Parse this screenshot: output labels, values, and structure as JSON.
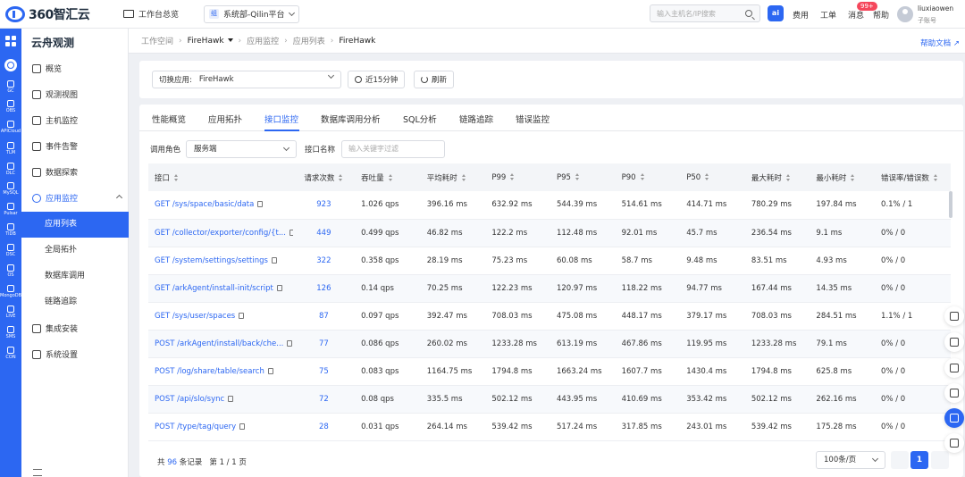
{
  "topbar": {
    "logo_text": "360智汇云",
    "workspace_overview": "工作台总览",
    "org_badge": "组",
    "org_name": "系统部-Qilin平台",
    "search_placeholder": "输入主机名/IP搜索",
    "ai_label": "ai",
    "links": {
      "cost": "费用",
      "ticket": "工单",
      "message": "消息",
      "help": "帮助"
    },
    "message_badge": "99+",
    "user_name": "liuxiaowen",
    "user_role": "子账号"
  },
  "rail": {
    "items": [
      "GC",
      "OBS",
      "APICloud",
      "TLM",
      "DLC",
      "MySQL",
      "Pulsar",
      "TiDB",
      "DSC",
      "OS",
      "MongoDB",
      "LIVE",
      "SMS",
      "CON"
    ]
  },
  "sidenav": {
    "title": "云舟观测",
    "items": [
      {
        "label": "概览"
      },
      {
        "label": "观测视图"
      },
      {
        "label": "主机监控"
      },
      {
        "label": "事件告警"
      },
      {
        "label": "数据探索"
      },
      {
        "label": "应用监控"
      }
    ],
    "subitems": [
      "应用列表",
      "全局拓扑",
      "数据库调用",
      "链路追踪"
    ],
    "bottom_items": [
      {
        "label": "集成安装"
      },
      {
        "label": "系统设置"
      }
    ]
  },
  "breadcrumb": {
    "items": [
      "工作空间",
      "FireHawk",
      "应用监控",
      "应用列表",
      "FireHawk"
    ],
    "help_doc": "帮助文档"
  },
  "filterbar": {
    "switch_app_label": "切换应用:",
    "switch_app_value": "FireHawk",
    "time_range": "近15分钟",
    "refresh": "刷新"
  },
  "tabs": [
    "性能概览",
    "应用拓扑",
    "接口监控",
    "数据库调用分析",
    "SQL分析",
    "链路追踪",
    "错误监控"
  ],
  "filters": {
    "role_label": "调用角色",
    "role_value": "服务端",
    "api_label": "接口名称",
    "api_placeholder": "输入关键字过滤"
  },
  "table": {
    "headers": [
      "接口",
      "请求次数",
      "吞吐量",
      "平均耗时",
      "P99",
      "P95",
      "P90",
      "P50",
      "最大耗时",
      "最小耗时",
      "错误率/错误数"
    ],
    "rows": [
      [
        "GET /sys/space/basic/data",
        "923",
        "1.026 qps",
        "396.16 ms",
        "632.92 ms",
        "544.39 ms",
        "514.61 ms",
        "414.71 ms",
        "780.29 ms",
        "197.84 ms",
        "0.1% / 1"
      ],
      [
        "GET /collector/exporter/config/{t...",
        "449",
        "0.499 qps",
        "46.82 ms",
        "122.2 ms",
        "112.48 ms",
        "92.01 ms",
        "45.7 ms",
        "236.54 ms",
        "9.1 ms",
        "0% / 0"
      ],
      [
        "GET /system/settings/settings",
        "322",
        "0.358 qps",
        "28.19 ms",
        "75.23 ms",
        "60.08 ms",
        "58.7 ms",
        "9.48 ms",
        "83.51 ms",
        "4.93 ms",
        "0% / 0"
      ],
      [
        "GET /arkAgent/install-init/script",
        "126",
        "0.14 qps",
        "70.25 ms",
        "122.23 ms",
        "120.97 ms",
        "118.22 ms",
        "94.77 ms",
        "167.44 ms",
        "14.35 ms",
        "0% / 0"
      ],
      [
        "GET /sys/user/spaces",
        "87",
        "0.097 qps",
        "392.47 ms",
        "708.03 ms",
        "475.08 ms",
        "448.17 ms",
        "379.17 ms",
        "708.03 ms",
        "284.51 ms",
        "1.1% / 1"
      ],
      [
        "POST /arkAgent/install/back/che...",
        "77",
        "0.086 qps",
        "260.02 ms",
        "1233.28 ms",
        "613.19 ms",
        "467.86 ms",
        "119.95 ms",
        "1233.28 ms",
        "79.1 ms",
        "0% / 0"
      ],
      [
        "POST /log/share/table/search",
        "75",
        "0.083 qps",
        "1164.75 ms",
        "1794.8 ms",
        "1663.24 ms",
        "1607.7 ms",
        "1430.4 ms",
        "1794.8 ms",
        "625.8 ms",
        "0% / 0"
      ],
      [
        "POST /api/slo/sync",
        "72",
        "0.08 qps",
        "335.5 ms",
        "502.12 ms",
        "443.95 ms",
        "410.69 ms",
        "353.42 ms",
        "502.12 ms",
        "262.16 ms",
        "0% / 0"
      ],
      [
        "POST /type/tag/query",
        "28",
        "0.031 qps",
        "264.14 ms",
        "539.42 ms",
        "517.24 ms",
        "317.85 ms",
        "243.01 ms",
        "539.42 ms",
        "175.28 ms",
        "0% / 0"
      ],
      [
        "",
        "",
        "",
        "",
        "",
        "",
        "",
        "",
        "",
        "",
        ""
      ]
    ]
  },
  "footer": {
    "total_prefix": "共",
    "total_count": "96",
    "total_suffix": "条记录",
    "page_info": "第 1 / 1 页",
    "page_size": "100条/页",
    "current_page": "1"
  }
}
